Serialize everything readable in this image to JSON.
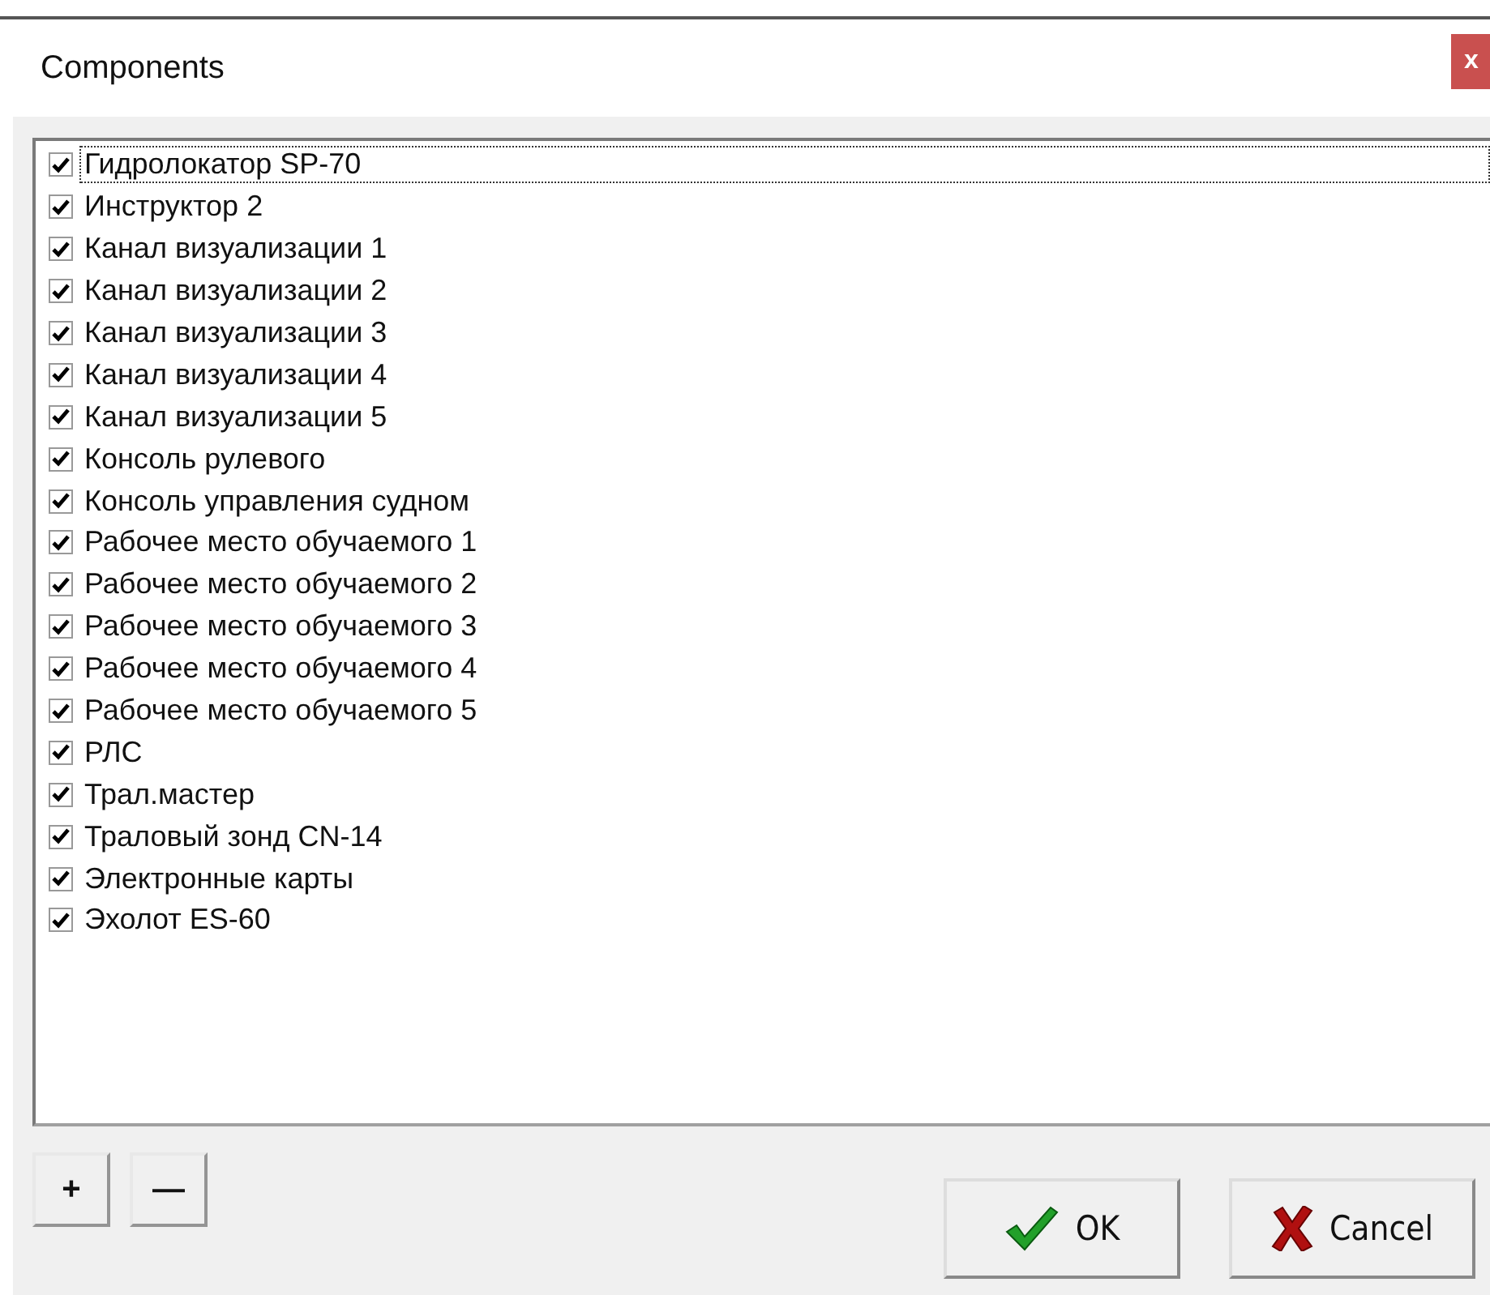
{
  "window": {
    "title": "Components",
    "close_label": "x"
  },
  "items": [
    {
      "label": "Гидролокатор SP-70",
      "checked": true,
      "focused": true
    },
    {
      "label": "Инструктор 2",
      "checked": true,
      "focused": false
    },
    {
      "label": "Канал визуализации 1",
      "checked": true,
      "focused": false
    },
    {
      "label": "Канал визуализации 2",
      "checked": true,
      "focused": false
    },
    {
      "label": "Канал визуализации 3",
      "checked": true,
      "focused": false
    },
    {
      "label": "Канал визуализации 4",
      "checked": true,
      "focused": false
    },
    {
      "label": "Канал визуализации 5",
      "checked": true,
      "focused": false
    },
    {
      "label": "Консоль рулевого",
      "checked": true,
      "focused": false
    },
    {
      "label": "Консоль управления судном",
      "checked": true,
      "focused": false
    },
    {
      "label": "Рабочее место обучаемого 1",
      "checked": true,
      "focused": false
    },
    {
      "label": "Рабочее место обучаемого 2",
      "checked": true,
      "focused": false
    },
    {
      "label": "Рабочее место обучаемого 3",
      "checked": true,
      "focused": false
    },
    {
      "label": "Рабочее место обучаемого 4",
      "checked": true,
      "focused": false
    },
    {
      "label": "Рабочее место обучаемого 5",
      "checked": true,
      "focused": false
    },
    {
      "label": "РЛС",
      "checked": true,
      "focused": false
    },
    {
      "label": "Трал.мастер",
      "checked": true,
      "focused": false
    },
    {
      "label": "Траловый зонд CN-14",
      "checked": true,
      "focused": false
    },
    {
      "label": "Электронные карты",
      "checked": true,
      "focused": false
    },
    {
      "label": "Эхолот ES-60",
      "checked": true,
      "focused": false
    }
  ],
  "add_button": "+",
  "remove_button": "—",
  "buttons": [
    {
      "kind": "ok",
      "label": "OK"
    },
    {
      "kind": "cancel",
      "label": "Cancel"
    }
  ]
}
